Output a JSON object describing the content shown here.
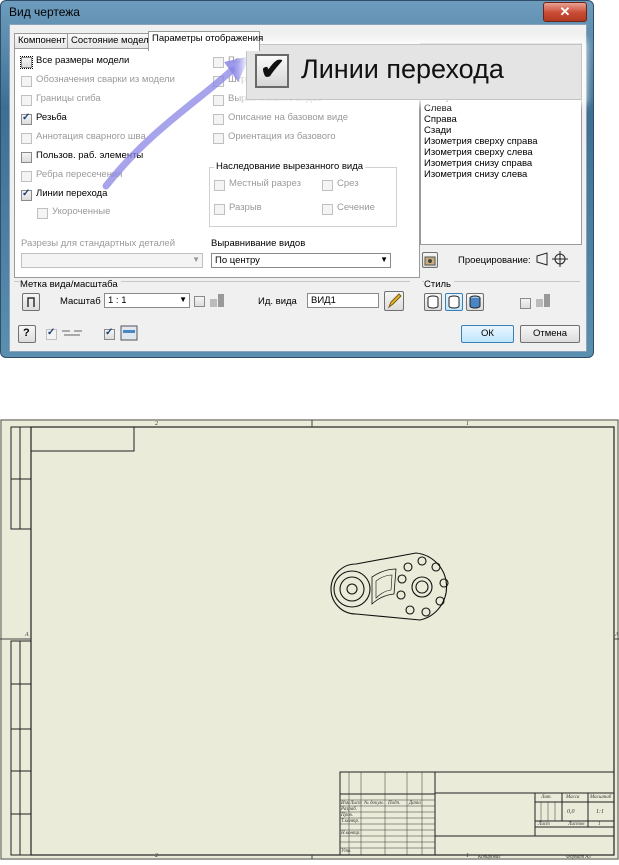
{
  "dialog": {
    "title": "Вид чертежа",
    "close_glyph": "✕",
    "tabs": [
      "Компонент",
      "Состояние модели",
      "Параметры отображения"
    ],
    "left_options": [
      {
        "label": "Все размеры модели",
        "checked": false,
        "enabled": true
      },
      {
        "label": "Обозначения сварки из модели",
        "checked": false,
        "enabled": false
      },
      {
        "label": "Границы сгиба",
        "checked": false,
        "enabled": false
      },
      {
        "label": "Резьба",
        "checked": true,
        "enabled": true
      },
      {
        "label": "Аннотация сварного шва",
        "checked": false,
        "enabled": false
      },
      {
        "label": "Пользов. раб. элементы",
        "checked": false,
        "enabled": true
      },
      {
        "label": "Ребра пересечения",
        "checked": false,
        "enabled": false
      },
      {
        "label": "Линии перехода",
        "checked": true,
        "enabled": true
      },
      {
        "label": "Укороченные",
        "checked": false,
        "enabled": false
      }
    ],
    "mid_options": [
      {
        "label": "Показ",
        "enabled": false
      },
      {
        "label": "Штрих",
        "enabled": false
      },
      {
        "label": "Выравнивание видов",
        "enabled": false
      },
      {
        "label": "Описание на базовом виде",
        "enabled": false
      },
      {
        "label": "Ориентация из базового",
        "enabled": false
      }
    ],
    "section_group": {
      "title": "Наследование вырезанного вида",
      "items": [
        "Местный разрез",
        "Срез",
        "Разрыв",
        "Сечение"
      ]
    },
    "std_parts": {
      "label": "Разрезы для стандартных деталей",
      "value": ""
    },
    "alignment": {
      "label": "Выравнивание видов",
      "value": "По центру"
    },
    "orientation_list": [
      "Снизу",
      "Слева",
      "Справа",
      "Сзади",
      "Изометрия сверху справа",
      "Изометрия сверху слева",
      "Изометрия снизу справа",
      "Изометрия снизу слева"
    ],
    "projection_label": "Проецирование:",
    "label_scale_title": "Метка вида/масштаба",
    "scale_label": "Масштаб",
    "scale_value": "1 : 1",
    "view_id_label": "Ид. вида",
    "view_id_value": "ВИД1",
    "style_label": "Стиль",
    "ok": "ОК",
    "cancel": "Отмена",
    "help_glyph": "?"
  },
  "zoom_callout": {
    "label": "Линии перехода",
    "check_glyph": "✔"
  },
  "drawing": {
    "zone_top": [
      "2",
      "1"
    ],
    "zone_side": "A",
    "title_block": {
      "cols": [
        "Изм",
        "Лист",
        "№ докум.",
        "Подп.",
        "Дата"
      ],
      "rows": [
        "Разраб.",
        "Пров.",
        "Т.контр.",
        "Н.контр.",
        "Утв."
      ],
      "lit": "Лит.",
      "mass": "Масса",
      "scale": "Масштаб",
      "mass_value": "0,0",
      "scale_value": "1:1",
      "sheet": "Лист",
      "sheets": "Листов",
      "sheets_value": "1",
      "copied": "Копировал",
      "format": "Формат A3"
    }
  }
}
